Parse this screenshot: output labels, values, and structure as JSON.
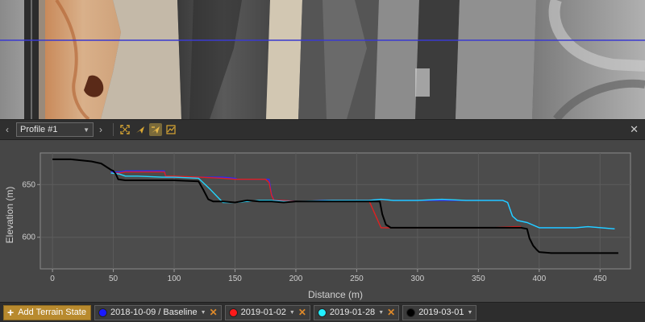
{
  "toolbar": {
    "prev_icon": "chevron-left-icon",
    "next_icon": "chevron-right-icon",
    "profile_name": "Profile #1",
    "tools": [
      "fit-extent-icon",
      "draw-profile-icon",
      "edit-profile-icon",
      "fit-view-icon"
    ],
    "close_icon": "close-icon"
  },
  "chart_data": {
    "type": "line",
    "xlabel": "Distance (m)",
    "ylabel": "Elevation (m)",
    "xlim": [
      -10,
      475
    ],
    "ylim": [
      570,
      680
    ],
    "xticks": [
      0,
      50,
      100,
      150,
      200,
      250,
      300,
      350,
      400,
      450
    ],
    "yticks": [
      600,
      650
    ],
    "grid": true,
    "series": [
      {
        "name": "2018-10-09 / Baseline",
        "color": "#2a2aff",
        "x": [
          48,
          55,
          60,
          92,
          93,
          100,
          140,
          150,
          152,
          160,
          170,
          175,
          178,
          180,
          182,
          190,
          200,
          210,
          220,
          240,
          260,
          270,
          280,
          300,
          340,
          360,
          370,
          374,
          378,
          382,
          390,
          400,
          430,
          440,
          462
        ],
        "y": [
          662,
          662,
          663,
          663,
          657,
          657,
          657,
          656,
          655,
          655,
          655,
          655,
          655,
          641,
          635,
          635,
          634,
          634,
          635,
          635,
          635,
          636,
          635,
          635,
          635,
          635,
          635,
          633,
          620,
          616,
          614,
          609,
          609,
          610,
          608
        ]
      },
      {
        "name": "2019-01-02",
        "color": "#e02020",
        "x": [
          48,
          55,
          60,
          92,
          93,
          100,
          140,
          150,
          160,
          175,
          178,
          180,
          182,
          190,
          200,
          230,
          260,
          270,
          280,
          300,
          340,
          360,
          380,
          385
        ],
        "y": [
          661,
          661,
          662,
          662,
          658,
          658,
          656,
          655,
          655,
          655,
          652,
          640,
          635,
          635,
          634,
          635,
          635,
          609,
          609,
          609,
          609,
          609,
          610,
          610
        ]
      },
      {
        "name": "2019-01-28",
        "color": "#22d8ff",
        "x": [
          48,
          55,
          60,
          70,
          90,
          100,
          120,
          130,
          140,
          150,
          160,
          170,
          180,
          190,
          200,
          230,
          260,
          270,
          280,
          300,
          320,
          340,
          360,
          370,
          374,
          378,
          382,
          390,
          400,
          430,
          440,
          462
        ],
        "y": [
          661,
          660,
          658,
          658,
          657,
          657,
          656,
          645,
          633,
          633,
          634,
          635,
          635,
          634,
          634,
          635,
          635,
          636,
          635,
          635,
          636,
          635,
          635,
          635,
          633,
          620,
          616,
          614,
          609,
          609,
          610,
          608
        ]
      },
      {
        "name": "2019-03-01",
        "color": "#000000",
        "x": [
          0,
          15,
          32,
          40,
          48,
          50,
          52,
          54,
          60,
          80,
          100,
          120,
          124,
          128,
          132,
          140,
          150,
          160,
          170,
          180,
          190,
          200,
          220,
          240,
          260,
          269,
          271,
          274,
          278,
          282,
          290,
          300,
          320,
          340,
          360,
          380,
          385,
          390,
          392,
          395,
          398,
          400,
          410,
          430,
          450,
          465
        ],
        "y": [
          674,
          674,
          672,
          670,
          664,
          663,
          660,
          655,
          654,
          654,
          654,
          653,
          645,
          636,
          634,
          634,
          633,
          635,
          634,
          634,
          633,
          634,
          634,
          634,
          634,
          634,
          622,
          612,
          609,
          609,
          609,
          609,
          609,
          609,
          609,
          609,
          609,
          608,
          599,
          592,
          588,
          586,
          585,
          585,
          585,
          585
        ]
      }
    ]
  },
  "bottombar": {
    "add_label": "Add Terrain State",
    "states": [
      {
        "label": "2018-10-09 / Baseline",
        "color": "#1a1aff",
        "removable": true
      },
      {
        "label": "2019-01-02",
        "color": "#ff1a1a",
        "removable": true
      },
      {
        "label": "2019-01-28",
        "color": "#22f0ff",
        "removable": true
      },
      {
        "label": "2019-03-01",
        "color": "#000000",
        "removable": false
      }
    ]
  }
}
